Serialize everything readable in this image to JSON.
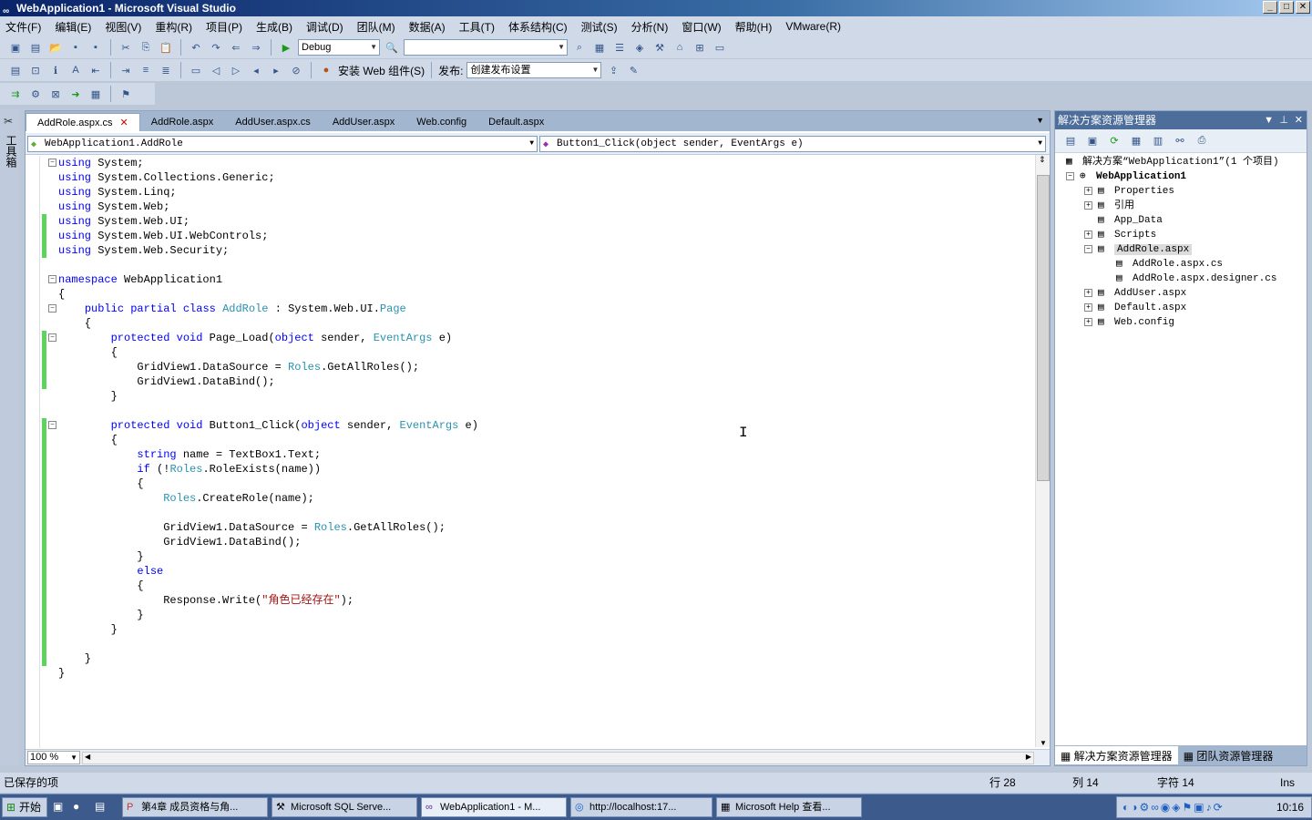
{
  "window": {
    "title": "WebApplication1 - Microsoft Visual Studio",
    "controls": [
      "_",
      "□",
      "✕"
    ]
  },
  "menu": [
    "文件(F)",
    "编辑(E)",
    "视图(V)",
    "重构(R)",
    "项目(P)",
    "生成(B)",
    "调试(D)",
    "团队(M)",
    "数据(A)",
    "工具(T)",
    "体系结构(C)",
    "测试(S)",
    "分析(N)",
    "窗口(W)",
    "帮助(H)",
    "VMware(R)"
  ],
  "toolbar": {
    "config": "Debug",
    "platform": "",
    "install_web_component": "安装 Web 组件(S)",
    "publish_label": "发布:",
    "publish_setting": "创建发布设置"
  },
  "toolbox_label": "工具箱",
  "editor": {
    "tabs": [
      "AddRole.aspx.cs",
      "AddRole.aspx",
      "AddUser.aspx.cs",
      "AddUser.aspx",
      "Web.config",
      "Default.aspx"
    ],
    "active_tab_close": "✕",
    "class_combo": "WebApplication1.AddRole",
    "member_combo": "Button1_Click(object sender, EventArgs e)",
    "zoom": "100 %"
  },
  "code_lines": [
    "using System;",
    "using System.Collections.Generic;",
    "using System.Linq;",
    "using System.Web;",
    "using System.Web.UI;",
    "using System.Web.UI.WebControls;",
    "using System.Web.Security;",
    "",
    "namespace WebApplication1",
    "{",
    "    public partial class AddRole : System.Web.UI.Page",
    "    {",
    "        protected void Page_Load(object sender, EventArgs e)",
    "        {",
    "            GridView1.DataSource = Roles.GetAllRoles();",
    "            GridView1.DataBind();",
    "        }",
    "",
    "        protected void Button1_Click(object sender, EventArgs e)",
    "        {",
    "            string name = TextBox1.Text;",
    "            if (!Roles.RoleExists(name))",
    "            {",
    "                Roles.CreateRole(name);",
    "",
    "                GridView1.DataSource = Roles.GetAllRoles();",
    "                GridView1.DataBind();",
    "            }",
    "            else",
    "            {",
    "                Response.Write(\"角色已经存在\");",
    "            }",
    "        }",
    "",
    "    }",
    "}"
  ],
  "solution_explorer": {
    "title": "解决方案资源管理器",
    "solution": "解决方案“WebApplication1”(1 个项目)",
    "project": "WebApplication1",
    "items": [
      {
        "label": "Properties",
        "icon": "properties-icon",
        "expand": "+"
      },
      {
        "label": "引用",
        "icon": "references-icon",
        "expand": "+"
      },
      {
        "label": "App_Data",
        "icon": "folder-icon",
        "expand": ""
      },
      {
        "label": "Scripts",
        "icon": "folder-icon",
        "expand": "+"
      },
      {
        "label": "AddRole.aspx",
        "icon": "aspx-file-icon",
        "expand": "−"
      },
      {
        "label": "AddRole.aspx.cs",
        "icon": "cs-file-icon",
        "expand": ""
      },
      {
        "label": "AddRole.aspx.designer.cs",
        "icon": "cs-file-icon",
        "expand": ""
      },
      {
        "label": "AddUser.aspx",
        "icon": "aspx-file-icon",
        "expand": "+"
      },
      {
        "label": "Default.aspx",
        "icon": "aspx-file-icon",
        "expand": "+"
      },
      {
        "label": "Web.config",
        "icon": "config-file-icon",
        "expand": "+"
      }
    ],
    "bottom_tabs": [
      "解决方案资源管理器",
      "团队资源管理器"
    ]
  },
  "status": {
    "message": "已保存的项",
    "line": "行 28",
    "col": "列 14",
    "char": "字符 14",
    "mode": "Ins"
  },
  "taskbar": {
    "start": "开始",
    "tasks": [
      "第4章 成员资格与角...",
      "Microsoft SQL Serve...",
      "WebApplication1 - M...",
      "http://localhost:17...",
      "Microsoft Help 查看..."
    ],
    "clock": "10:16"
  },
  "colors": {
    "keyword": "#0000ff",
    "type": "#2b91af",
    "string": "#a31515",
    "change_bar": "#5fd35f"
  }
}
